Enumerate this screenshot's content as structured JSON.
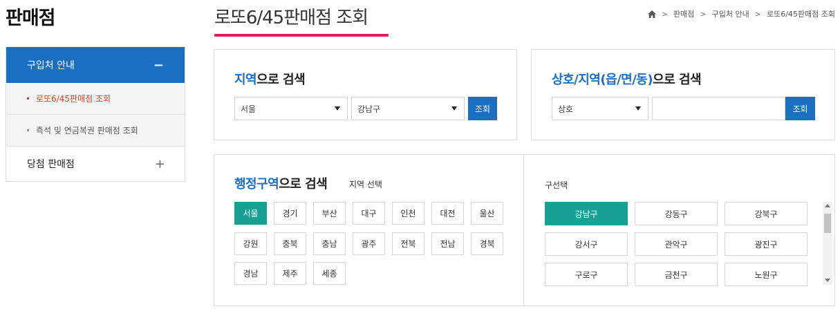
{
  "sidebar": {
    "title": "판매점",
    "main_menu": {
      "label": "구입처 안내",
      "toggle": "−"
    },
    "sub_items": [
      {
        "label": "로또6/45판매점 조회"
      },
      {
        "label": "즉석 및 연금복권 판매점 조회"
      }
    ],
    "other_menu": {
      "label": "당첨 판매점",
      "toggle": "+"
    }
  },
  "page": {
    "title": "로또6/45판매점 조회"
  },
  "breadcrumb": {
    "items": [
      "판매점",
      "구입처 안내",
      "로또6/45판매점 조회"
    ],
    "separator": ">"
  },
  "region_search": {
    "heading_highlight": "지역",
    "heading_rest": "으로 검색",
    "city_select": "서울",
    "district_select": "강남구",
    "button": "조회"
  },
  "name_search": {
    "heading_highlight": "상호/지역(읍/면/동)",
    "heading_rest": "으로 검색",
    "type_select": "상호",
    "input_value": "",
    "button": "조회"
  },
  "admin_search": {
    "heading_highlight": "행정구역",
    "heading_rest": "으로 검색",
    "region_label": "지역 선택",
    "district_label": "구선택",
    "regions": [
      "서울",
      "경기",
      "부산",
      "대구",
      "인천",
      "대전",
      "울산",
      "강원",
      "충북",
      "충남",
      "광주",
      "전북",
      "전남",
      "경북",
      "경남",
      "제주",
      "세종"
    ],
    "active_region": "서울",
    "districts": [
      "강남구",
      "강동구",
      "강북구",
      "강서구",
      "관악구",
      "광진구",
      "구로구",
      "금천구",
      "노원구"
    ],
    "active_district": "강남구"
  },
  "colors": {
    "primary_blue": "#1a6fc2",
    "teal_active": "#17a094",
    "title_underline": "#e5175b",
    "active_sub_item": "#d6432b"
  }
}
